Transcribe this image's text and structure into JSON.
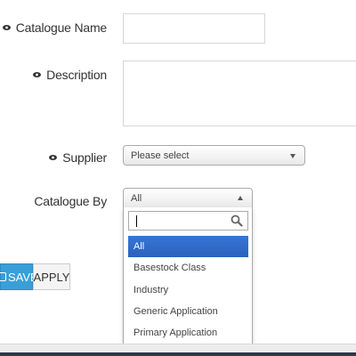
{
  "form": {
    "catalogue_name": {
      "label": "Catalogue Name",
      "value": ""
    },
    "description": {
      "label": "Description",
      "value": ""
    },
    "supplier": {
      "label": "Supplier",
      "selected": "Please select"
    },
    "catalogue_by": {
      "label": "Catalogue By",
      "selected": "All",
      "search_value": "",
      "options": [
        "All",
        "Basestock Class",
        "Industry",
        "Generic Application",
        "Primary Application"
      ],
      "highlighted_option": "All"
    }
  },
  "buttons": {
    "save_label": "SAVE",
    "apply_label": "APPLY"
  },
  "colors": {
    "accent": "#3a9fd8",
    "highlight": "#3875d7"
  },
  "icons": {
    "visibility": "eye-icon",
    "search": "magnifier-icon",
    "save": "save-icon"
  }
}
